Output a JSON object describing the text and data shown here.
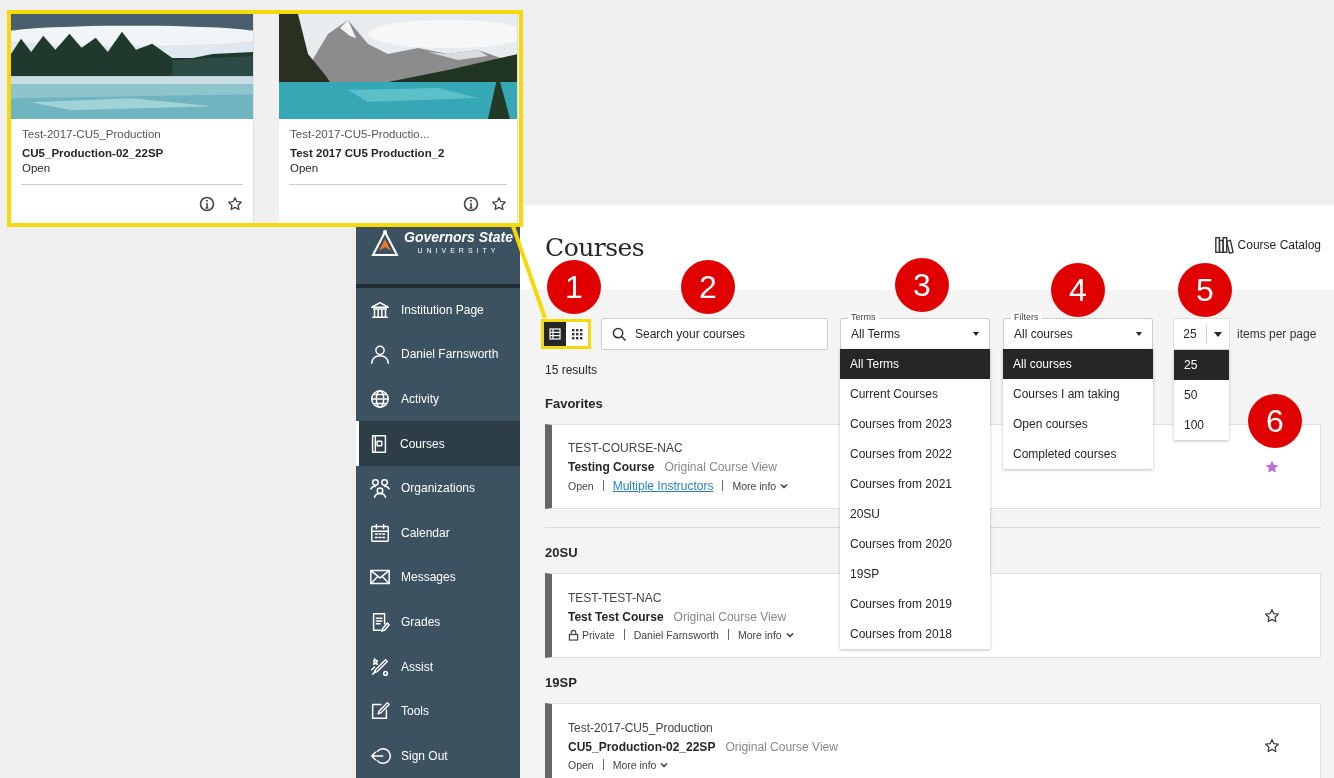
{
  "inset": {
    "cards": [
      {
        "code": "Test-2017-CU5_Production",
        "name": "CU5_Production-02_22SP",
        "status": "Open",
        "favorite": false
      },
      {
        "code": "Test-2017-CU5-Productio...",
        "name": "Test 2017 CU5 Production_2",
        "status": "Open",
        "favorite": false
      }
    ]
  },
  "sidebar": {
    "logo": {
      "name": "Governors State",
      "subtitle": "UNIVERSITY"
    },
    "items": [
      {
        "label": "Institution Page",
        "selected": false
      },
      {
        "label": "Daniel Farnsworth",
        "selected": false
      },
      {
        "label": "Activity",
        "selected": false
      },
      {
        "label": "Courses",
        "selected": true
      },
      {
        "label": "Organizations",
        "selected": false
      },
      {
        "label": "Calendar",
        "selected": false
      },
      {
        "label": "Messages",
        "selected": false
      },
      {
        "label": "Grades",
        "selected": false
      },
      {
        "label": "Assist",
        "selected": false
      },
      {
        "label": "Tools",
        "selected": false
      },
      {
        "label": "Sign Out",
        "selected": false
      }
    ]
  },
  "header": {
    "title": "Courses",
    "catalog_link": "Course Catalog"
  },
  "toolbar": {
    "view_toggle": [
      {
        "selected": true
      },
      {
        "selected": false
      }
    ],
    "search": {
      "placeholder": "Search your courses"
    },
    "terms": {
      "label": "Terms",
      "value": "All Terms",
      "expanded": true,
      "options": [
        {
          "label": "All Terms",
          "selected": true
        },
        {
          "label": "Current Courses",
          "selected": false
        },
        {
          "label": "Courses from 2023",
          "selected": false
        },
        {
          "label": "Courses from 2022",
          "selected": false
        },
        {
          "label": "Courses from 2021",
          "selected": false
        },
        {
          "label": "20SU",
          "selected": false
        },
        {
          "label": "Courses from 2020",
          "selected": false
        },
        {
          "label": "19SP",
          "selected": false
        },
        {
          "label": "Courses from 2019",
          "selected": false
        },
        {
          "label": "Courses from 2018",
          "selected": false
        }
      ]
    },
    "filters": {
      "label": "Filters",
      "value": "All courses",
      "expanded": true,
      "options": [
        {
          "label": "All courses",
          "selected": true
        },
        {
          "label": "Courses I am taking",
          "selected": false
        },
        {
          "label": "Open courses",
          "selected": false
        },
        {
          "label": "Completed courses",
          "selected": false
        }
      ]
    },
    "per_page": {
      "value": "25",
      "suffix": "items per page",
      "expanded": true,
      "options": [
        {
          "label": "25",
          "selected": true
        },
        {
          "label": "50",
          "selected": false
        },
        {
          "label": "100",
          "selected": false
        }
      ]
    }
  },
  "results_count": "15 results",
  "sections": [
    {
      "heading": "Favorites",
      "courses": [
        {
          "code": "TEST-COURSE-NAC",
          "name": "Testing Course",
          "view": "Original Course View",
          "favorite": true,
          "meta": [
            {
              "kind": "text",
              "text": "Open"
            },
            {
              "kind": "link",
              "text": "Multiple Instructors"
            },
            {
              "kind": "more",
              "text": "More info"
            }
          ]
        }
      ]
    },
    {
      "heading": "20SU",
      "courses": [
        {
          "code": "TEST-TEST-NAC",
          "name": "Test Test Course",
          "view": "Original Course View",
          "favorite": false,
          "meta": [
            {
              "kind": "locked",
              "text": "Private"
            },
            {
              "kind": "text",
              "text": "Daniel Farnsworth"
            },
            {
              "kind": "more",
              "text": "More info"
            }
          ]
        }
      ]
    },
    {
      "heading": "19SP",
      "courses": [
        {
          "code": "Test-2017-CU5_Production",
          "name": "CU5_Production-02_22SP",
          "view": "Original Course View",
          "favorite": false,
          "meta": [
            {
              "kind": "text",
              "text": "Open"
            },
            {
              "kind": "more",
              "text": "More info"
            }
          ]
        }
      ]
    }
  ],
  "annotations": [
    {
      "number": "1"
    },
    {
      "number": "2"
    },
    {
      "number": "3"
    },
    {
      "number": "4"
    },
    {
      "number": "5"
    },
    {
      "number": "6"
    }
  ]
}
